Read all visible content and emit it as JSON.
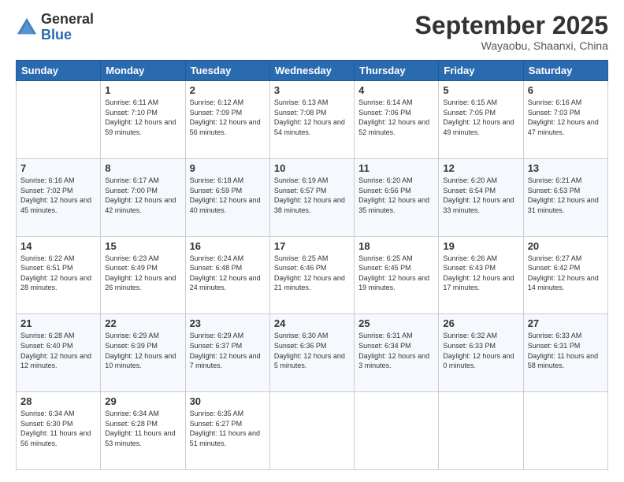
{
  "header": {
    "logo_general": "General",
    "logo_blue": "Blue",
    "month_title": "September 2025",
    "subtitle": "Wayaobu, Shaanxi, China"
  },
  "days_of_week": [
    "Sunday",
    "Monday",
    "Tuesday",
    "Wednesday",
    "Thursday",
    "Friday",
    "Saturday"
  ],
  "weeks": [
    [
      {
        "day": "",
        "info": ""
      },
      {
        "day": "1",
        "info": "Sunrise: 6:11 AM\nSunset: 7:10 PM\nDaylight: 12 hours\nand 59 minutes."
      },
      {
        "day": "2",
        "info": "Sunrise: 6:12 AM\nSunset: 7:09 PM\nDaylight: 12 hours\nand 56 minutes."
      },
      {
        "day": "3",
        "info": "Sunrise: 6:13 AM\nSunset: 7:08 PM\nDaylight: 12 hours\nand 54 minutes."
      },
      {
        "day": "4",
        "info": "Sunrise: 6:14 AM\nSunset: 7:06 PM\nDaylight: 12 hours\nand 52 minutes."
      },
      {
        "day": "5",
        "info": "Sunrise: 6:15 AM\nSunset: 7:05 PM\nDaylight: 12 hours\nand 49 minutes."
      },
      {
        "day": "6",
        "info": "Sunrise: 6:16 AM\nSunset: 7:03 PM\nDaylight: 12 hours\nand 47 minutes."
      }
    ],
    [
      {
        "day": "7",
        "info": "Sunrise: 6:16 AM\nSunset: 7:02 PM\nDaylight: 12 hours\nand 45 minutes."
      },
      {
        "day": "8",
        "info": "Sunrise: 6:17 AM\nSunset: 7:00 PM\nDaylight: 12 hours\nand 42 minutes."
      },
      {
        "day": "9",
        "info": "Sunrise: 6:18 AM\nSunset: 6:59 PM\nDaylight: 12 hours\nand 40 minutes."
      },
      {
        "day": "10",
        "info": "Sunrise: 6:19 AM\nSunset: 6:57 PM\nDaylight: 12 hours\nand 38 minutes."
      },
      {
        "day": "11",
        "info": "Sunrise: 6:20 AM\nSunset: 6:56 PM\nDaylight: 12 hours\nand 35 minutes."
      },
      {
        "day": "12",
        "info": "Sunrise: 6:20 AM\nSunset: 6:54 PM\nDaylight: 12 hours\nand 33 minutes."
      },
      {
        "day": "13",
        "info": "Sunrise: 6:21 AM\nSunset: 6:53 PM\nDaylight: 12 hours\nand 31 minutes."
      }
    ],
    [
      {
        "day": "14",
        "info": "Sunrise: 6:22 AM\nSunset: 6:51 PM\nDaylight: 12 hours\nand 28 minutes."
      },
      {
        "day": "15",
        "info": "Sunrise: 6:23 AM\nSunset: 6:49 PM\nDaylight: 12 hours\nand 26 minutes."
      },
      {
        "day": "16",
        "info": "Sunrise: 6:24 AM\nSunset: 6:48 PM\nDaylight: 12 hours\nand 24 minutes."
      },
      {
        "day": "17",
        "info": "Sunrise: 6:25 AM\nSunset: 6:46 PM\nDaylight: 12 hours\nand 21 minutes."
      },
      {
        "day": "18",
        "info": "Sunrise: 6:25 AM\nSunset: 6:45 PM\nDaylight: 12 hours\nand 19 minutes."
      },
      {
        "day": "19",
        "info": "Sunrise: 6:26 AM\nSunset: 6:43 PM\nDaylight: 12 hours\nand 17 minutes."
      },
      {
        "day": "20",
        "info": "Sunrise: 6:27 AM\nSunset: 6:42 PM\nDaylight: 12 hours\nand 14 minutes."
      }
    ],
    [
      {
        "day": "21",
        "info": "Sunrise: 6:28 AM\nSunset: 6:40 PM\nDaylight: 12 hours\nand 12 minutes."
      },
      {
        "day": "22",
        "info": "Sunrise: 6:29 AM\nSunset: 6:39 PM\nDaylight: 12 hours\nand 10 minutes."
      },
      {
        "day": "23",
        "info": "Sunrise: 6:29 AM\nSunset: 6:37 PM\nDaylight: 12 hours\nand 7 minutes."
      },
      {
        "day": "24",
        "info": "Sunrise: 6:30 AM\nSunset: 6:36 PM\nDaylight: 12 hours\nand 5 minutes."
      },
      {
        "day": "25",
        "info": "Sunrise: 6:31 AM\nSunset: 6:34 PM\nDaylight: 12 hours\nand 3 minutes."
      },
      {
        "day": "26",
        "info": "Sunrise: 6:32 AM\nSunset: 6:33 PM\nDaylight: 12 hours\nand 0 minutes."
      },
      {
        "day": "27",
        "info": "Sunrise: 6:33 AM\nSunset: 6:31 PM\nDaylight: 11 hours\nand 58 minutes."
      }
    ],
    [
      {
        "day": "28",
        "info": "Sunrise: 6:34 AM\nSunset: 6:30 PM\nDaylight: 11 hours\nand 56 minutes."
      },
      {
        "day": "29",
        "info": "Sunrise: 6:34 AM\nSunset: 6:28 PM\nDaylight: 11 hours\nand 53 minutes."
      },
      {
        "day": "30",
        "info": "Sunrise: 6:35 AM\nSunset: 6:27 PM\nDaylight: 11 hours\nand 51 minutes."
      },
      {
        "day": "",
        "info": ""
      },
      {
        "day": "",
        "info": ""
      },
      {
        "day": "",
        "info": ""
      },
      {
        "day": "",
        "info": ""
      }
    ]
  ]
}
